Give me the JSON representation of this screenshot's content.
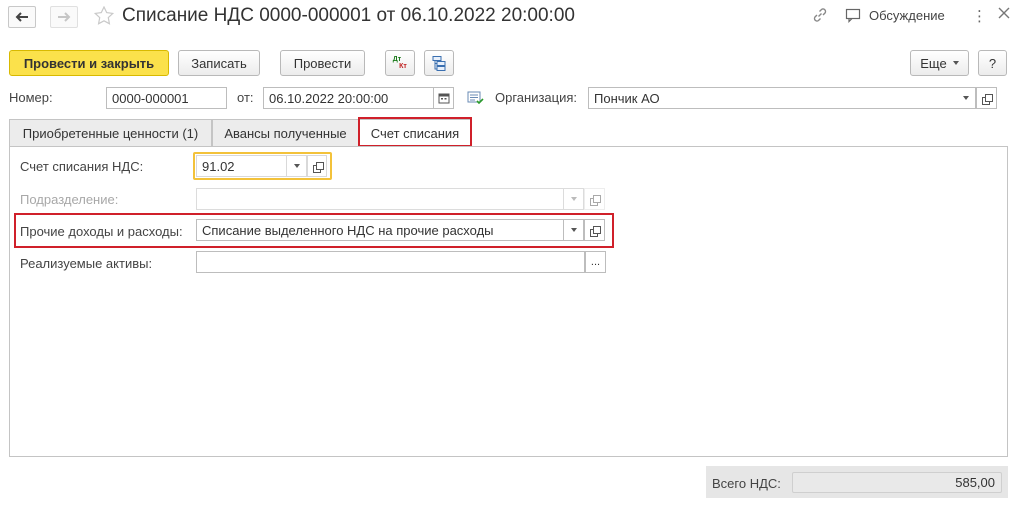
{
  "window": {
    "title": "Списание НДС 0000-000001 от 06.10.2022 20:00:00",
    "discussion_label": "Обсуждение"
  },
  "toolbar": {
    "post_close_label": "Провести и закрыть",
    "save_label": "Записать",
    "post_label": "Провести",
    "dt_label": "Дт",
    "kt_label": "Кт",
    "more_label": "Еще",
    "help_label": "?"
  },
  "header": {
    "number_label": "Номер:",
    "number_value": "0000-000001",
    "date_label": "от:",
    "date_value": "06.10.2022 20:00:00",
    "org_label": "Организация:",
    "org_value": "Пончик АО"
  },
  "tabs": [
    {
      "label": "Приобретенные ценности (1)"
    },
    {
      "label": "Авансы полученные"
    },
    {
      "label": "Счет списания"
    }
  ],
  "writeoff": {
    "account_label": "Счет списания НДС:",
    "account_value": "91.02",
    "division_label": "Подразделение:",
    "division_value": "",
    "other_label": "Прочие доходы и расходы:",
    "other_value": "Списание выделенного НДС на прочие расходы",
    "assets_label": "Реализуемые активы:",
    "assets_value": "",
    "assets_button": "..."
  },
  "totals": {
    "vat_label": "Всего НДС:",
    "vat_value": "585,00"
  },
  "colors": {
    "accent_yellow": "#fbe14b",
    "highlight_red": "#d0202a",
    "focus_yellow": "#f3c23a"
  }
}
